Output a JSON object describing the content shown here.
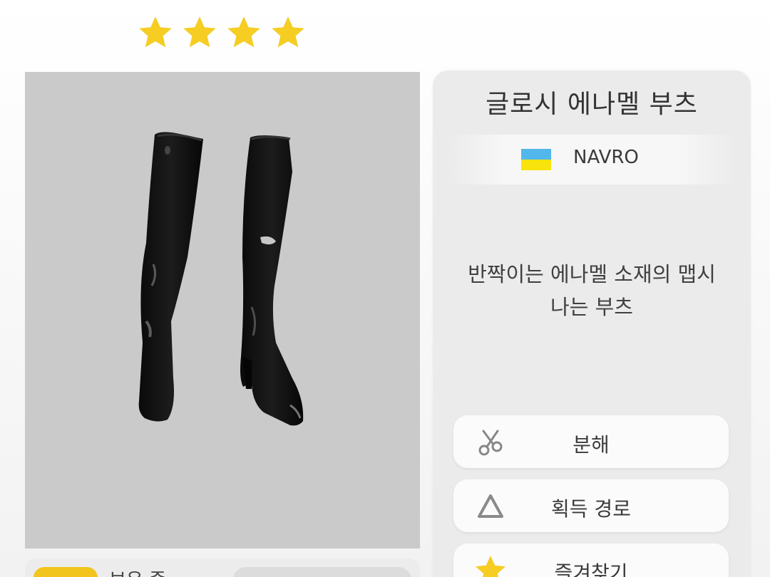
{
  "rarity": {
    "stars": 4,
    "color": "#f5cd23"
  },
  "item": {
    "name": "글로시 에나멜 부츠",
    "brand": "NAVRO",
    "brand_flag_colors": [
      "#52b7ea",
      "#f8e40c"
    ],
    "description_line1": "반짝이는 에나멜 소재의 맵시",
    "description_line2": "나는 부츠"
  },
  "actions": {
    "disassemble_label": "분해",
    "acquire_label": "획득 경로",
    "favorite_label": "즐겨찾기"
  },
  "owned": {
    "label": "보유 중"
  },
  "icons": {
    "rarity_star": "star-icon",
    "disassemble": "scissors-icon",
    "acquire": "triangle-icon",
    "favorite": "star-icon"
  },
  "colors": {
    "accent": "#f5cd23",
    "preview_background": "#cacaca"
  }
}
